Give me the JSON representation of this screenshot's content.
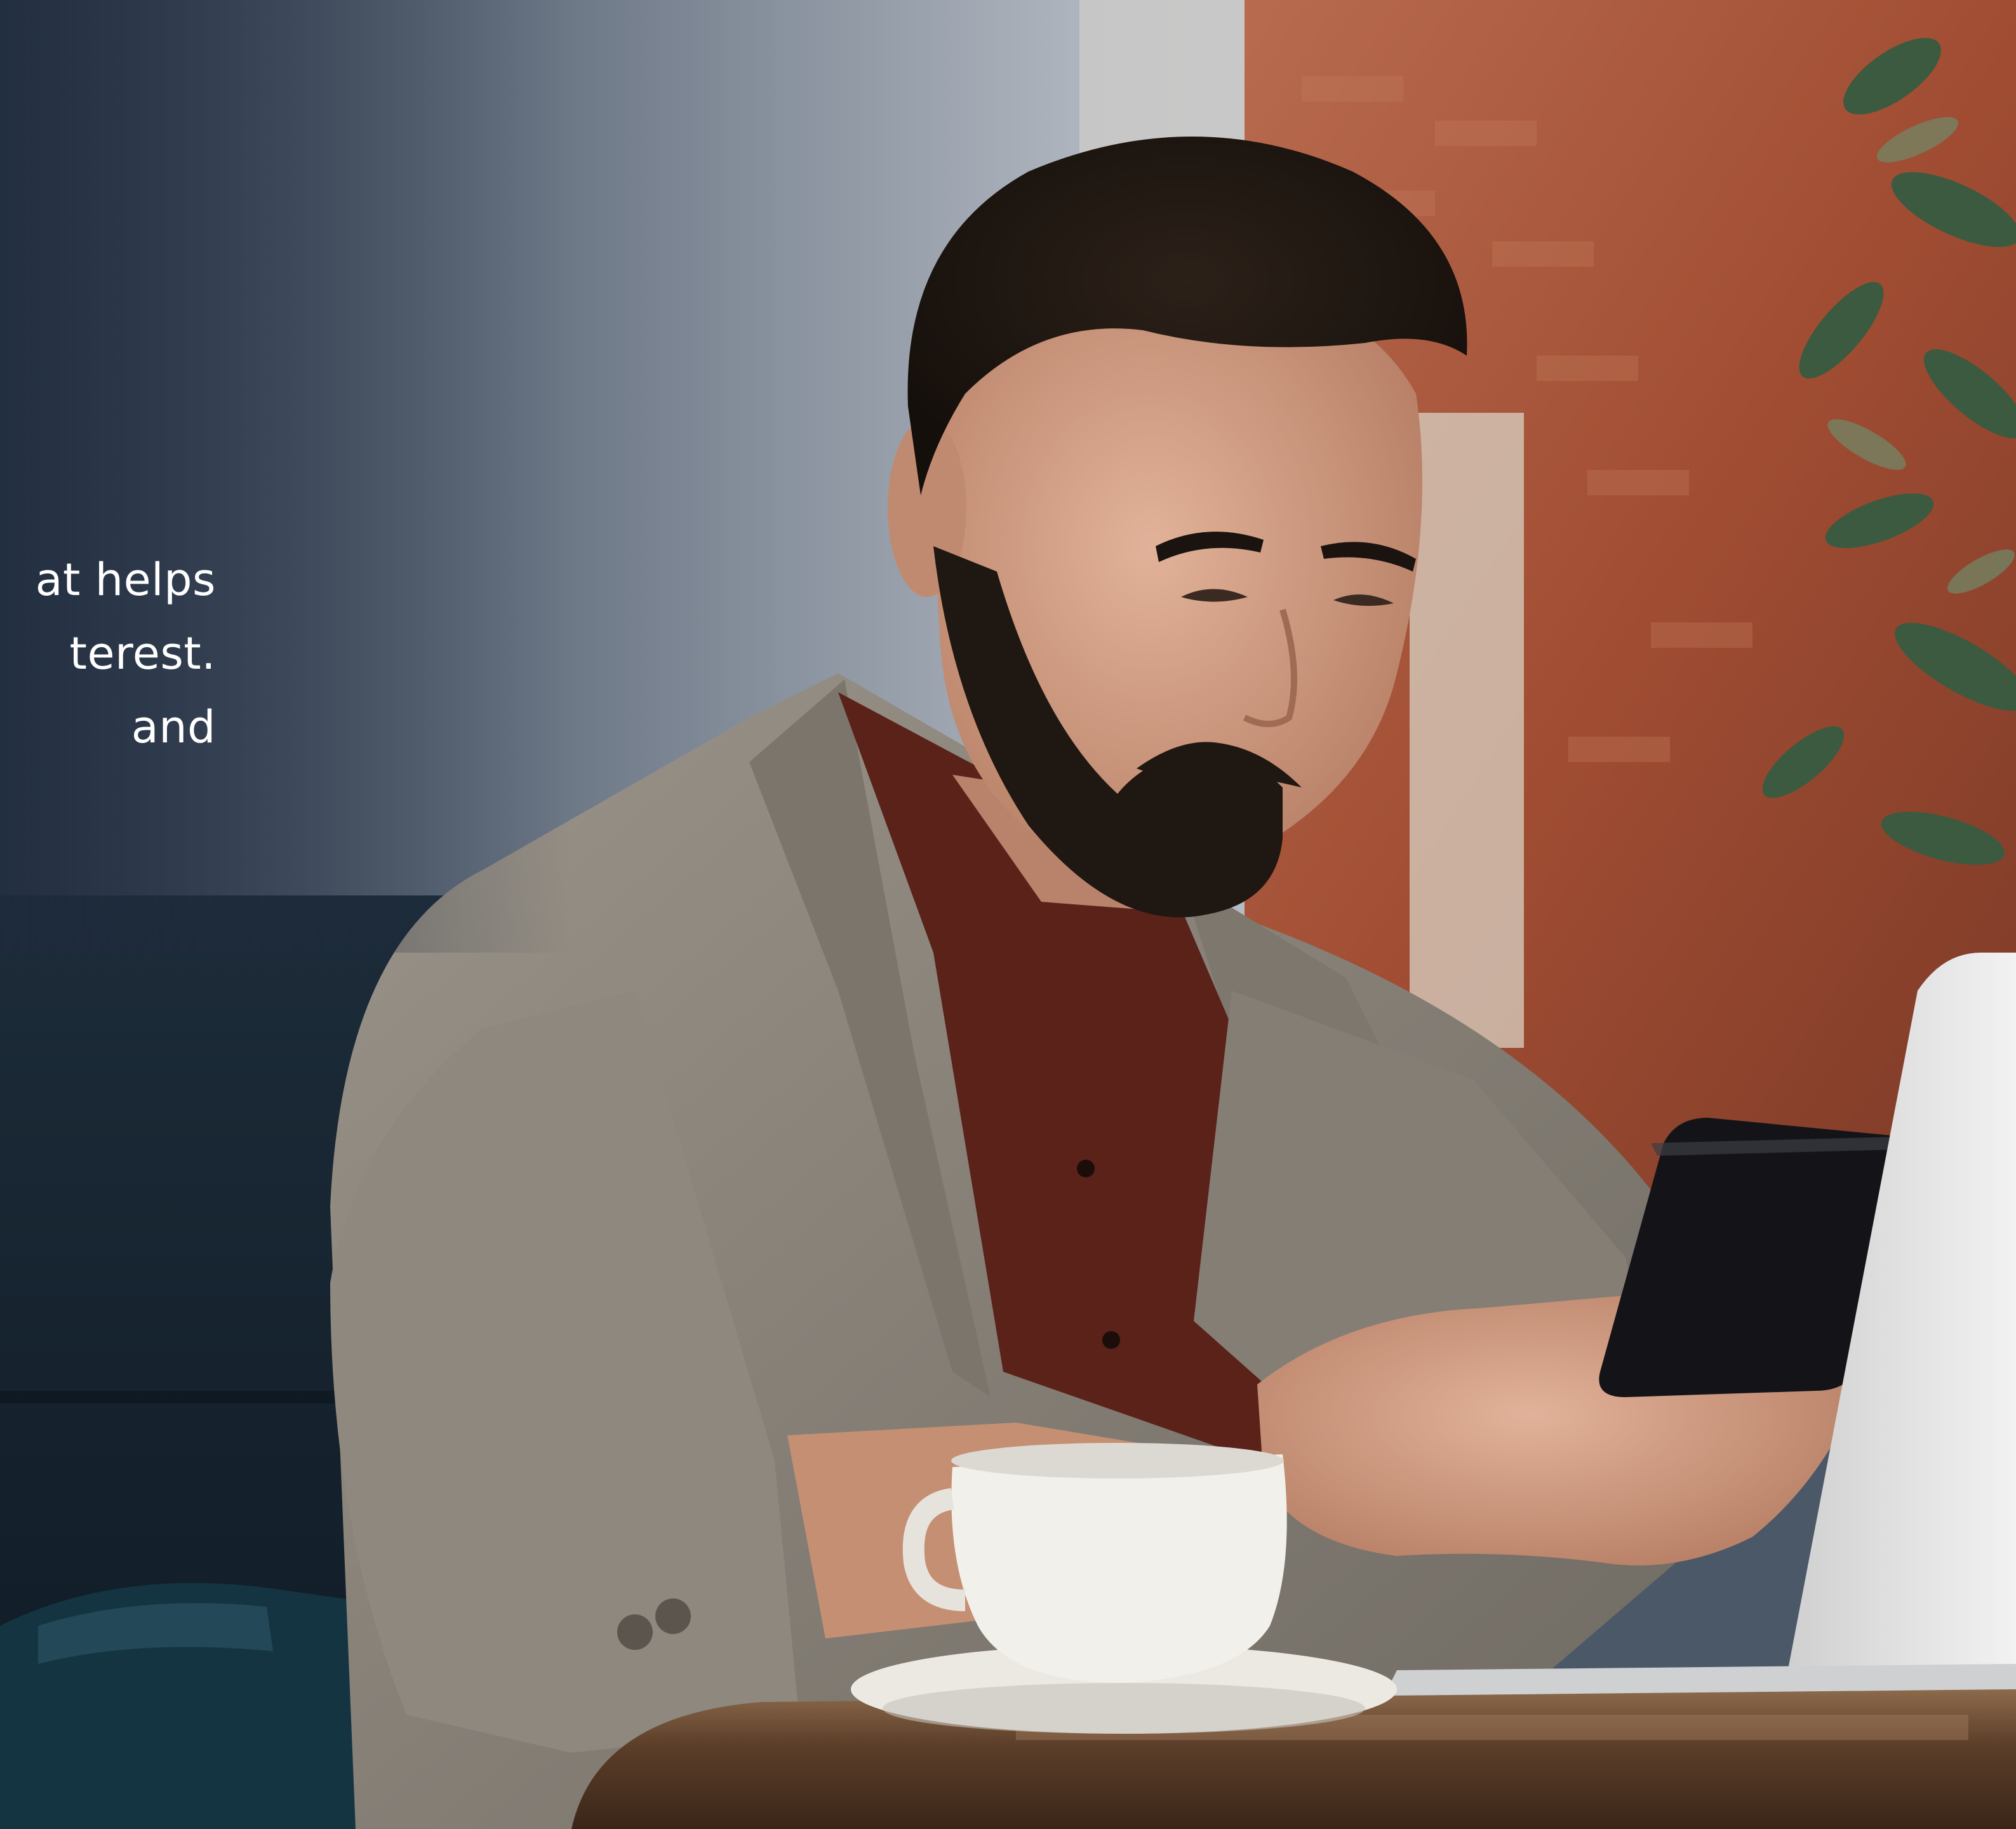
{
  "hero": {
    "lines": [
      "at helps",
      "terest.",
      "and"
    ]
  },
  "photo": {
    "subject": "photo-man-with-phone-at-cafe",
    "colors": {
      "wall": "#b9bec6",
      "wall_left": "#3d4a5c",
      "brick": "#a8553a",
      "blazer": "#8a847b",
      "shirt": "#5a2219",
      "skin": "#d3a086",
      "hair": "#1d1510",
      "table": "#6a4a32",
      "cup": "#f1efe9",
      "laptop": "#e1e1e1",
      "chair": "#143441",
      "plant": "#3b5a3f"
    }
  }
}
